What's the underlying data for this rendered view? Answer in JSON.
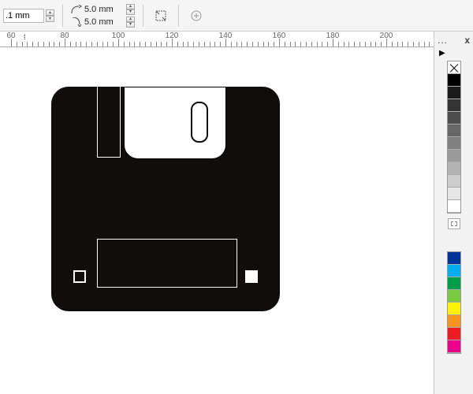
{
  "toolbar": {
    "stroke_width": ".1 mm",
    "dim_x": "5.0 mm",
    "dim_y": "5.0 mm"
  },
  "ruler": {
    "labels": [
      "60",
      "80",
      "100",
      "120",
      "140",
      "160",
      "180",
      "200"
    ]
  },
  "panel": {
    "menu": "...",
    "close": "x",
    "arrow": "▶"
  },
  "palette_gray": [
    "#000000",
    "#1a1a1a",
    "#333333",
    "#4d4d4d",
    "#666666",
    "#808080",
    "#999999",
    "#b3b3b3",
    "#cccccc",
    "#e6e6e6",
    "#ffffff"
  ],
  "palette_color": [
    "#003399",
    "#00aeef",
    "#009e49",
    "#7ac943",
    "#fff200",
    "#f7941e",
    "#ed1c24",
    "#ec008c"
  ]
}
